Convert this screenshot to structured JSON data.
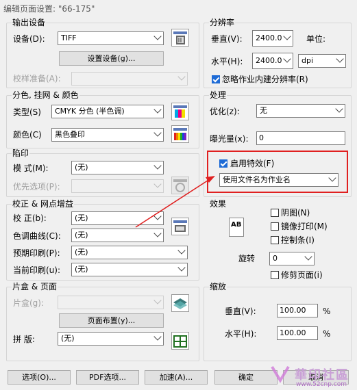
{
  "window": {
    "title": "编辑页面设置: \"66-175\""
  },
  "output": {
    "group_label": "输出设备",
    "device_label": "设备(D):",
    "device_value": "TIFF",
    "setup_button": "设置设备(g)...",
    "proof_label": "校样准备(A):"
  },
  "color": {
    "group_label": "分色, 挂网 & 颜色",
    "type_label": "类型(S)",
    "type_value": "CMYK 分色 (半色调)",
    "color_label": "颜色(C)",
    "color_value": "黑色叠印"
  },
  "trap": {
    "group_label": "陷印",
    "mode_label": "模   式(M):",
    "mode_value": "(无)",
    "pref_label": "优先选项(P):"
  },
  "correction": {
    "group_label": "校正 & 网点增益",
    "correct_label": "校   正(b):",
    "correct_value": "(无)",
    "curve_label": "色调曲线(C):",
    "curve_value": "(无)",
    "pre_label": "预期印刷(P):",
    "pre_value": "(无)",
    "cur_label": "当前印刷(u):",
    "cur_value": "(无)"
  },
  "film": {
    "group_label": "片盒 & 页面",
    "box_label": "片盒(g):",
    "layout_button": "页面布置(y)...",
    "imposition_label": "拼   版:",
    "imposition_value": "(无)"
  },
  "resolution": {
    "group_label": "分辨率",
    "v_label": "垂直(V):",
    "v_value": "2400.0",
    "unit_label": "单位:",
    "h_label": "水平(H):",
    "h_value": "2400.0",
    "unit_value": "dpi",
    "ignore_label": "忽略作业内建分辨率(R)"
  },
  "process": {
    "group_label": "处理",
    "optimize_label": "优化(z):",
    "optimize_value": "无",
    "exposure_label": "曝光量(x):",
    "exposure_value": "0",
    "effects_label": "启用特效(F)",
    "effects_value": "使用文件名为作业名"
  },
  "effects": {
    "group_label": "效果",
    "icon_text": "AB",
    "negative_label": "阴图(N)",
    "mirror_label": "镜像打印(M)",
    "control_label": "控制条(I)",
    "rotate_label": "旋转",
    "rotate_value": "0",
    "crop_label": "修剪页面(i)"
  },
  "scale": {
    "group_label": "缩放",
    "v_label": "垂直(V):",
    "v_value": "100.00",
    "v_unit": "%",
    "h_label": "水平(H):",
    "h_value": "100.00",
    "h_unit": "%"
  },
  "footer": {
    "options_button": "选项(O)...",
    "pdf_button": "PDF选项...",
    "accel_button": "加速(A)...",
    "ok_button": "确定",
    "cancel_button": "取消"
  },
  "watermark": {
    "text": "華印社區",
    "url": "www.52cnp.com"
  },
  "colors": {
    "highlight": "#e02020",
    "accent": "#1e6bd6"
  }
}
